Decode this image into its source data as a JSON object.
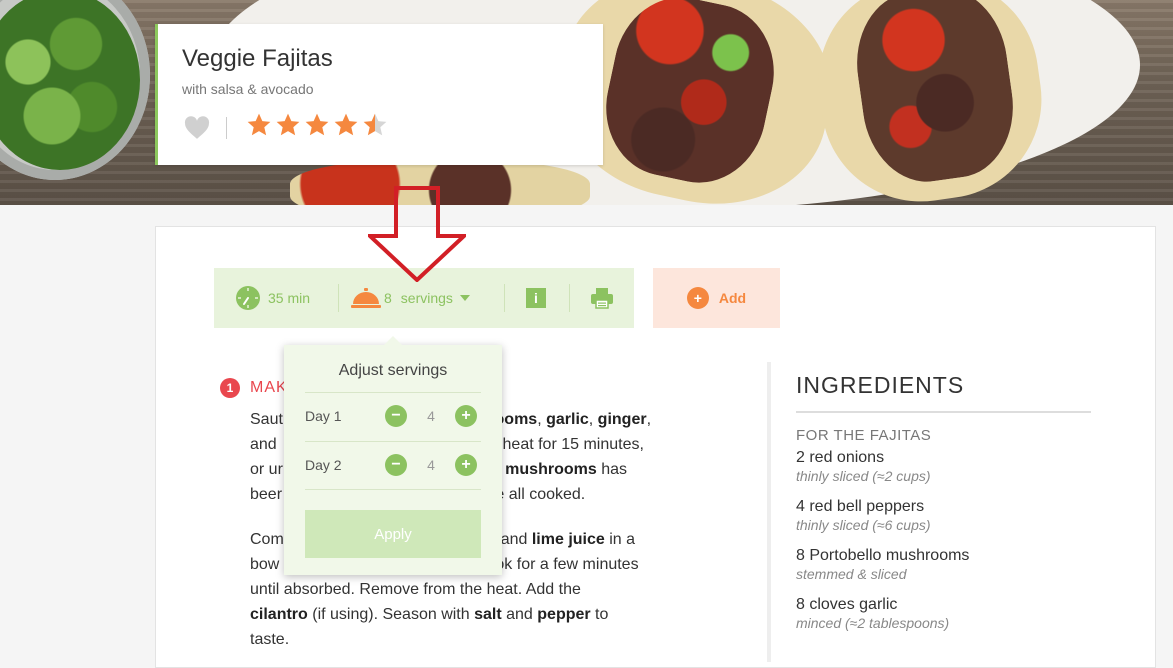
{
  "recipe": {
    "title": "Veggie Fajitas",
    "subtitle": "with salsa & avocado",
    "rating": 4.5,
    "rating_max": 5
  },
  "info_bar": {
    "time": "35 min",
    "servings_count": "8",
    "servings_label": "servings",
    "info_icon": "i"
  },
  "add_button": {
    "label": "Add",
    "icon": "+"
  },
  "servings_popup": {
    "title": "Adjust servings",
    "rows": [
      {
        "label": "Day 1",
        "value": "4",
        "minus": "−",
        "plus": "+"
      },
      {
        "label": "Day 2",
        "value": "4",
        "minus": "−",
        "plus": "+"
      }
    ],
    "apply_label": "Apply"
  },
  "steps": [
    {
      "number": "1",
      "title": "MAK"
    }
  ],
  "ingredients": {
    "heading": "INGREDIENTS",
    "section": "FOR THE FAJITAS",
    "items": [
      {
        "name": "2 red onions",
        "note": "thinly sliced (≈2 cups)"
      },
      {
        "name": "4 red bell peppers",
        "note": "thinly sliced (≈6 cups)"
      },
      {
        "name": "8 Portobello mushrooms",
        "note": "stemmed & sliced"
      },
      {
        "name": "8 cloves garlic",
        "note": "minced (≈2 tablespoons)"
      }
    ]
  },
  "colors": {
    "accent_green": "#8cc260",
    "accent_orange": "#f5883f",
    "accent_red": "#e9474e",
    "arrow_red": "#d21f26"
  }
}
